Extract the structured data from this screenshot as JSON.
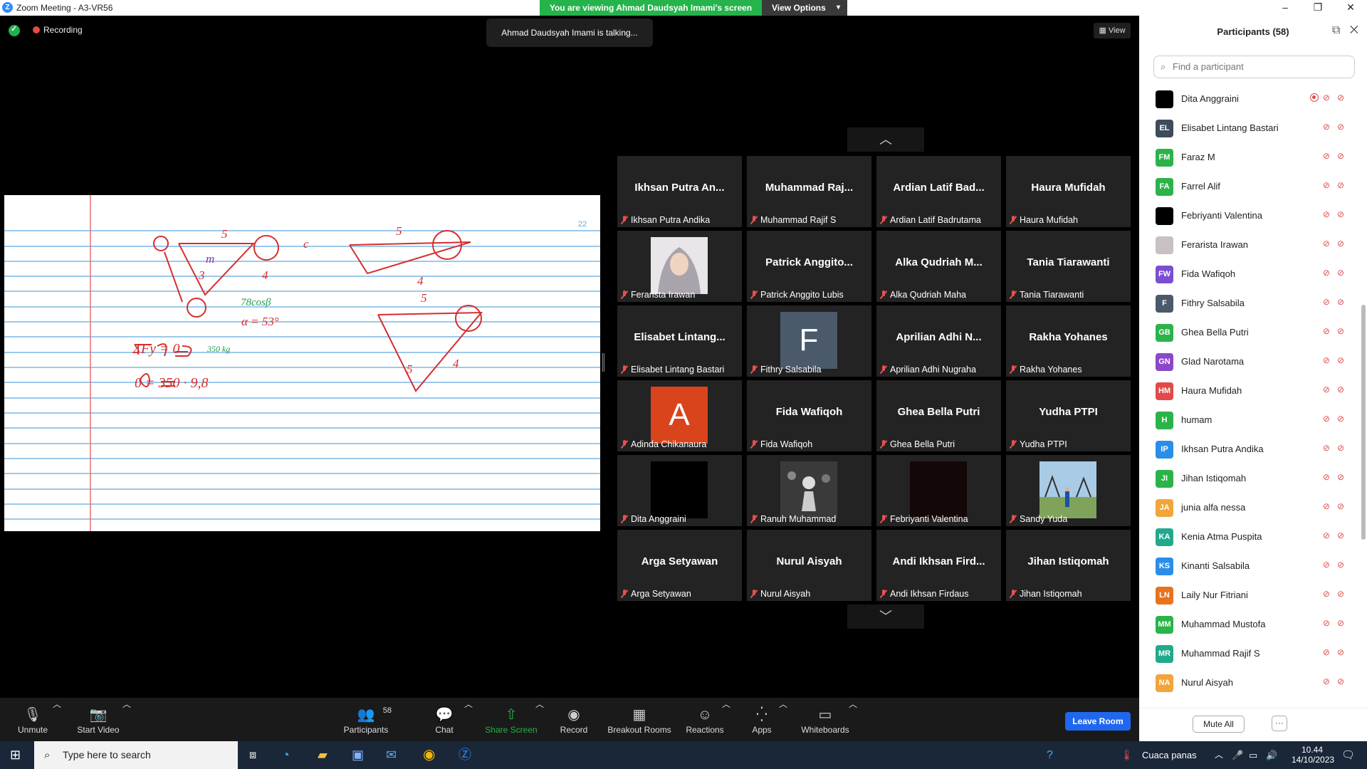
{
  "window": {
    "title": "Zoom Meeting - A3-VR56"
  },
  "banner": {
    "text": "You are viewing Ahmad Daudsyah Imami's screen",
    "view_options": "View Options"
  },
  "status": {
    "recording": "Recording",
    "talking": "Ahmad Daudsyah Imami is talking...",
    "view": "View"
  },
  "whiteboard": {
    "page_number": "22",
    "annotations": [
      "5",
      "5",
      "5",
      "c",
      "m",
      "3",
      "4",
      "4",
      "5",
      "4",
      "78cosβ",
      "α = 53°",
      "350 kg",
      "ΣFy = 0",
      "0 = 350 · 9,8"
    ]
  },
  "gallery": {
    "tiles": [
      {
        "name": "Ikhsan Putra An...",
        "label": "Ikhsan Putra Andika",
        "kind": "name"
      },
      {
        "name": "Muhammad Raj...",
        "label": "Muhammad Rajif S",
        "kind": "name"
      },
      {
        "name": "Ardian Latif Bad...",
        "label": "Ardian Latif Badrutama",
        "kind": "name"
      },
      {
        "name": "Haura Mufidah",
        "label": "Haura Mufidah",
        "kind": "name"
      },
      {
        "name": "",
        "label": "Ferarista Irawan",
        "kind": "photo-hijab"
      },
      {
        "name": "Patrick Anggito...",
        "label": "Patrick Anggito Lubis",
        "kind": "name"
      },
      {
        "name": "Alka Qudriah M...",
        "label": "Alka Qudriah Maha",
        "kind": "name"
      },
      {
        "name": "Tania Tiarawanti",
        "label": "Tania Tiarawanti",
        "kind": "name"
      },
      {
        "name": "Elisabet Lintang...",
        "label": "Elisabet Lintang Bastari",
        "kind": "name"
      },
      {
        "name": "F",
        "label": "Fithry Salsabila",
        "kind": "letter-slate"
      },
      {
        "name": "Aprilian Adhi N...",
        "label": "Aprilian Adhi Nugraha",
        "kind": "name"
      },
      {
        "name": "Rakha Yohanes",
        "label": "Rakha Yohanes",
        "kind": "name"
      },
      {
        "name": "A",
        "label": "Adinda Chikanaura",
        "kind": "letter-orange"
      },
      {
        "name": "Fida Wafiqoh",
        "label": "Fida Wafiqoh",
        "kind": "name"
      },
      {
        "name": "Ghea Bella Putri",
        "label": "Ghea Bella Putri",
        "kind": "name"
      },
      {
        "name": "Yudha PTPI",
        "label": "Yudha PTPI",
        "kind": "name"
      },
      {
        "name": "",
        "label": "Dita Anggraini",
        "kind": "photo-black"
      },
      {
        "name": "",
        "label": "Ranuh Muhammad",
        "kind": "photo-chess"
      },
      {
        "name": "",
        "label": "Febriyanti Valentina",
        "kind": "photo-dark"
      },
      {
        "name": "",
        "label": "Sandy Yuda",
        "kind": "photo-field"
      },
      {
        "name": "Arga Setyawan",
        "label": "Arga Setyawan",
        "kind": "name"
      },
      {
        "name": "Nurul Aisyah",
        "label": "Nurul Aisyah",
        "kind": "name"
      },
      {
        "name": "Andi Ikhsan Fird...",
        "label": "Andi Ikhsan Firdaus",
        "kind": "name"
      },
      {
        "name": "Jihan Istiqomah",
        "label": "Jihan Istiqomah",
        "kind": "name"
      }
    ]
  },
  "toolbar": {
    "unmute": "Unmute",
    "start_video": "Start Video",
    "participants": "Participants",
    "participants_count": "58",
    "chat": "Chat",
    "share_screen": "Share Screen",
    "record": "Record",
    "breakout": "Breakout Rooms",
    "reactions": "Reactions",
    "apps": "Apps",
    "whiteboards": "Whiteboards",
    "leave": "Leave Room"
  },
  "participants_panel": {
    "title": "Participants (58)",
    "search_placeholder": "Find a participant",
    "mute_all": "Mute All",
    "more": "···",
    "list": [
      {
        "initials": "",
        "name": "Dita Anggraini",
        "color": "#000000",
        "recording": true
      },
      {
        "initials": "EL",
        "name": "Elisabet Lintang Bastari",
        "color": "#3d4b5c"
      },
      {
        "initials": "FM",
        "name": "Faraz M",
        "color": "#2bb34a"
      },
      {
        "initials": "FA",
        "name": "Farrel Alif",
        "color": "#2bb34a"
      },
      {
        "initials": "",
        "name": "Febriyanti Valentina",
        "color": "#000000"
      },
      {
        "initials": "",
        "name": "Ferarista Irawan",
        "color": "#c9c0c6"
      },
      {
        "initials": "FW",
        "name": "Fida Wafiqoh",
        "color": "#7b4ed0"
      },
      {
        "initials": "F",
        "name": "Fithry Salsabila",
        "color": "#4a5a6b"
      },
      {
        "initials": "GB",
        "name": "Ghea Bella Putri",
        "color": "#2bb34a"
      },
      {
        "initials": "GN",
        "name": "Glad Narotama",
        "color": "#8a48c8"
      },
      {
        "initials": "HM",
        "name": "Haura Mufidah",
        "color": "#e24a4a"
      },
      {
        "initials": "H",
        "name": "humam",
        "color": "#2bb34a"
      },
      {
        "initials": "IP",
        "name": "Ikhsan Putra Andika",
        "color": "#2a8ee8"
      },
      {
        "initials": "JI",
        "name": "Jihan Istiqomah",
        "color": "#2bb34a"
      },
      {
        "initials": "JA",
        "name": "junia alfa nessa",
        "color": "#f1a53a"
      },
      {
        "initials": "KA",
        "name": "Kenia Atma Puspita",
        "color": "#21a98d"
      },
      {
        "initials": "KS",
        "name": "Kinanti Salsabila",
        "color": "#2a8ee8"
      },
      {
        "initials": "LN",
        "name": "Laily Nur Fitriani",
        "color": "#e8731e"
      },
      {
        "initials": "MM",
        "name": "Muhammad Mustofa",
        "color": "#2bb34a"
      },
      {
        "initials": "MR",
        "name": "Muhammad Rajif S",
        "color": "#21a98d"
      },
      {
        "initials": "NA",
        "name": "Nurul Aisyah",
        "color": "#f1a53a"
      }
    ]
  },
  "taskbar": {
    "search_placeholder": "Type here to search",
    "weather": "Cuaca panas",
    "time": "10.44",
    "date": "14/10/2023"
  }
}
